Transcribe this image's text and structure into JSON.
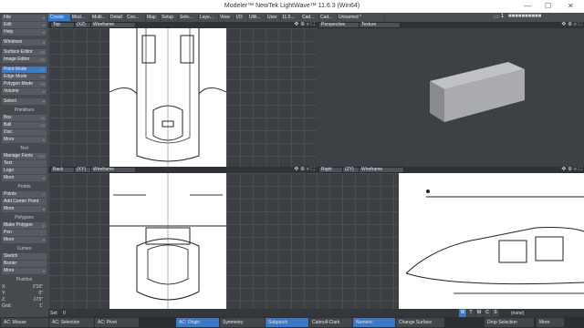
{
  "window": {
    "title": "Modeler™ NewTek LightWave™ 11.6.3 (Win64)",
    "minimize": "—",
    "maximize": "☐",
    "close": "✕"
  },
  "tabs": [
    "Create",
    "Mod...",
    "Multi...",
    "Detail",
    "Con...",
    "Map",
    "Setup",
    "Sele...",
    "Laye...",
    "View",
    "I/O",
    "Utili...",
    "User",
    "11.5...",
    "Cad...",
    "Cad...",
    "Unnamed *"
  ],
  "tab_right": {
    "layer_num": "1"
  },
  "sidebar": {
    "top": [
      {
        "label": "File",
        "key": "▾"
      },
      {
        "label": "Edit",
        "key": "▾"
      },
      {
        "label": "Help",
        "key": "▾"
      },
      {
        "label": "Windows",
        "key": "▾"
      },
      {
        "label": "Surface Editor",
        "key": "F5"
      },
      {
        "label": "Image Editor",
        "key": "F6"
      },
      {
        "label": "Point Mode",
        "key": "^G"
      },
      {
        "label": "Edge Mode",
        "key": "^H"
      },
      {
        "label": "Polygon Mode",
        "key": "^H"
      },
      {
        "label": "Volume",
        "key": "▾"
      },
      {
        "label": "Select",
        "key": "▾"
      }
    ],
    "primitives_title": "Primitives",
    "primitives": [
      {
        "label": "Box",
        "key": "+X"
      },
      {
        "label": "Ball",
        "key": "+O"
      },
      {
        "label": "Disc",
        "key": ""
      },
      {
        "label": "More",
        "key": "▾"
      }
    ],
    "text_title": "Text",
    "text": [
      {
        "label": "Manage Fonts",
        "key": "F10"
      },
      {
        "label": "Text",
        "key": ""
      },
      {
        "label": "Logo",
        "key": ""
      },
      {
        "label": "More",
        "key": "▾"
      }
    ],
    "points_title": "Points",
    "points": [
      {
        "label": "Points",
        "key": "+"
      },
      {
        "label": "Add Center Point",
        "key": ""
      },
      {
        "label": "More",
        "key": "▾"
      }
    ],
    "polygons_title": "Polygons",
    "polygons": [
      {
        "label": "Make Polygon",
        "key": "p"
      },
      {
        "label": "Pen",
        "key": ""
      },
      {
        "label": "More",
        "key": "▾"
      }
    ],
    "curves_title": "Curves",
    "curves": [
      {
        "label": "Sketch",
        "key": ""
      },
      {
        "label": "Bezier",
        "key": ""
      },
      {
        "label": "More",
        "key": "▾"
      }
    ],
    "position_title": "Position",
    "position": [
      {
        "axis": "X:",
        "value": "2'10\""
      },
      {
        "axis": "Y:",
        "value": "0\""
      },
      {
        "axis": "Z:",
        "value": "-173\""
      },
      {
        "axis": "Grid:",
        "value": "1'"
      }
    ]
  },
  "viewports": {
    "top_left": {
      "view": "Top",
      "axes": "(XZ)",
      "mode": "Wireframe"
    },
    "top_right": {
      "view": "Perspective",
      "mode": "Texture"
    },
    "bottom_left": {
      "view": "Back",
      "axes": "(XY)",
      "mode": "Wireframe"
    },
    "bottom_right": {
      "view": "Right",
      "axes": "(ZY)",
      "mode": "Wireframe"
    },
    "icons": "✥ ⊕ ⌕ ⛶"
  },
  "status": {
    "sel_label": "Sel:",
    "sel_value": "0",
    "wtmcs": [
      "W",
      "T",
      "M",
      "C",
      "S"
    ],
    "none": "(none)"
  },
  "bottom": [
    "AC: Mouse",
    "AC: Selection",
    "AC: Pivot",
    "AC: Origin",
    "Symmetry",
    "Subpatch",
    "Catmull-Clark",
    "Numeric",
    "Change Surface",
    "Drop Selection",
    "More"
  ],
  "bottom_highlight": [
    3,
    5,
    7
  ],
  "colors": {
    "accent": "#3a78c8",
    "panel": "#46494e",
    "viewport": "#3c3f44",
    "blueprint": "#ffffff"
  }
}
